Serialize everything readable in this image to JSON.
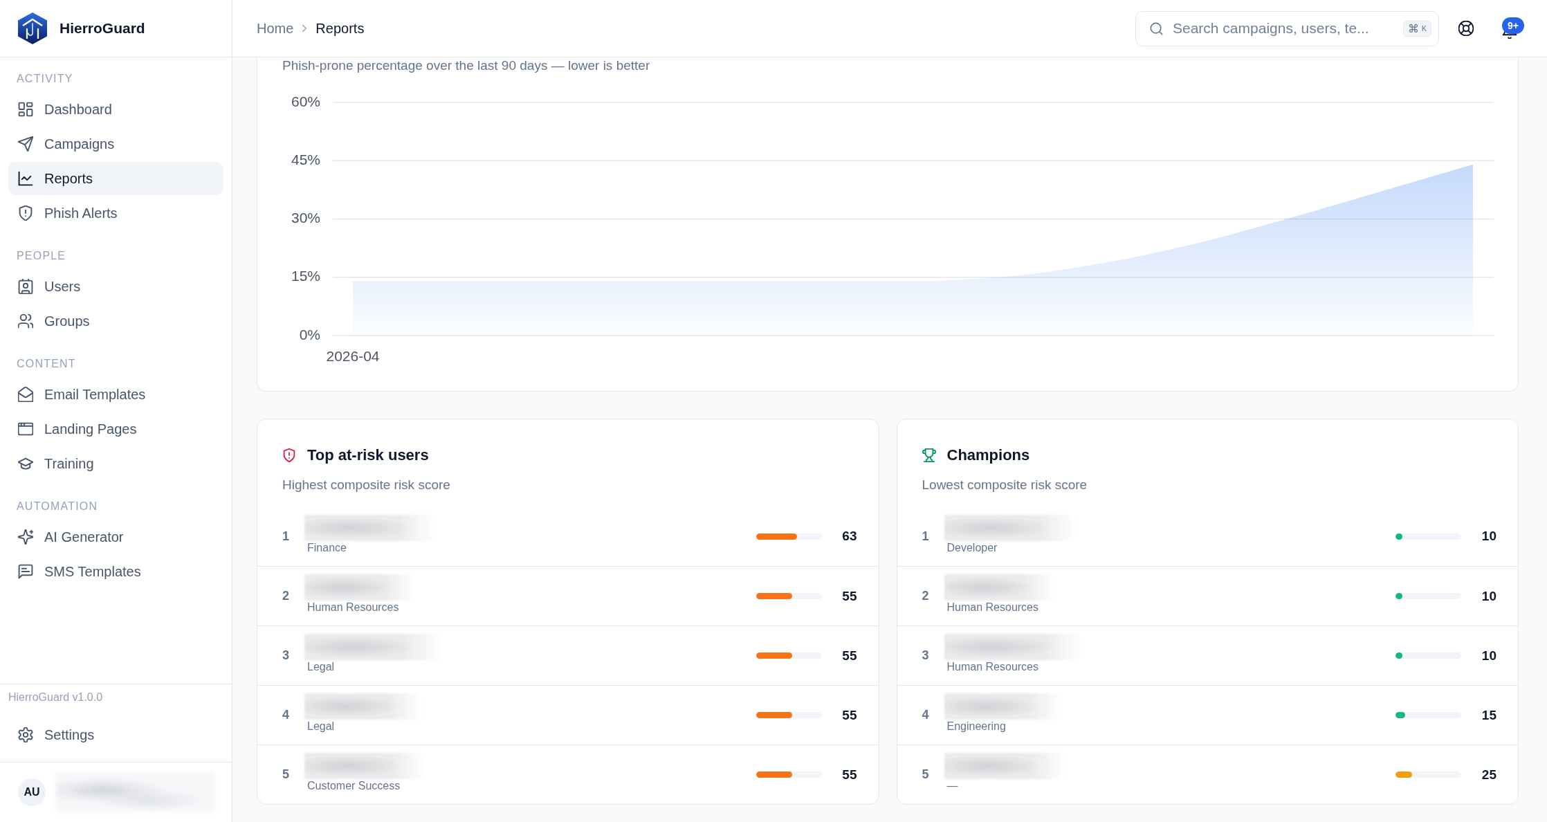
{
  "sidebar": {
    "brand": "HierroGuard",
    "sections": [
      {
        "label": "ACTIVITY",
        "items": [
          {
            "label": "Dashboard",
            "selected": false
          },
          {
            "label": "Campaigns",
            "selected": false
          },
          {
            "label": "Reports",
            "selected": true
          },
          {
            "label": "Phish Alerts",
            "selected": false
          }
        ]
      },
      {
        "label": "PEOPLE",
        "items": [
          {
            "label": "Users",
            "selected": false
          },
          {
            "label": "Groups",
            "selected": false
          }
        ]
      },
      {
        "label": "CONTENT",
        "items": [
          {
            "label": "Email Templates",
            "selected": false
          },
          {
            "label": "Landing Pages",
            "selected": false
          },
          {
            "label": "Training",
            "selected": false
          }
        ]
      },
      {
        "label": "AUTOMATION",
        "items": [
          {
            "label": "AI Generator",
            "selected": false
          },
          {
            "label": "SMS Templates",
            "selected": false
          }
        ]
      }
    ],
    "version": "HierroGuard v1.0.0",
    "settings": "Settings",
    "user": {
      "initials": "AU"
    }
  },
  "header": {
    "breadcrumb": [
      "Home",
      "Reports"
    ],
    "search": {
      "placeholder": "Search campaigns, users, te...",
      "shortcut": [
        "⌘",
        "K"
      ]
    },
    "notifications": {
      "badge": "9+"
    }
  },
  "trend_card": {
    "subtitle": "Phish-prone percentage over the last 90 days — lower is better",
    "x_axis_start": "2026-04",
    "chart_data": {
      "type": "area",
      "grid": true,
      "ylim": [
        0,
        60
      ],
      "yticks": [
        {
          "value": 0,
          "label": "0%"
        },
        {
          "value": 15,
          "label": "15%"
        },
        {
          "value": 30,
          "label": "30%"
        },
        {
          "value": 45,
          "label": "45%"
        },
        {
          "value": 60,
          "label": "60%"
        }
      ],
      "series": [
        {
          "values": [
            14,
            14,
            14,
            14,
            14,
            14,
            14,
            15.2,
            18.5,
            23.5,
            30,
            37,
            44
          ]
        }
      ]
    }
  },
  "at_risk": {
    "title": "Top at-risk users",
    "subtitle": "Highest composite risk score",
    "rows": [
      {
        "rank": "1",
        "department": "Finance",
        "level": 0.63,
        "score": "63",
        "color": "#f97316"
      },
      {
        "rank": "2",
        "department": "Human Resources",
        "level": 0.55,
        "score": "55",
        "color": "#f97316"
      },
      {
        "rank": "3",
        "department": "Legal",
        "level": 0.55,
        "score": "55",
        "color": "#f97316"
      },
      {
        "rank": "4",
        "department": "Legal",
        "level": 0.55,
        "score": "55",
        "color": "#f97316"
      },
      {
        "rank": "5",
        "department": "Customer Success",
        "level": 0.55,
        "score": "55",
        "color": "#f97316"
      }
    ]
  },
  "champions": {
    "title": "Champions",
    "subtitle": "Lowest composite risk score",
    "rows": [
      {
        "rank": "1",
        "department": "Developer",
        "level": 0.1,
        "score": "10",
        "color": "#10b981"
      },
      {
        "rank": "2",
        "department": "Human Resources",
        "level": 0.1,
        "score": "10",
        "color": "#10b981"
      },
      {
        "rank": "3",
        "department": "Human Resources",
        "level": 0.1,
        "score": "10",
        "color": "#10b981"
      },
      {
        "rank": "4",
        "department": "Engineering",
        "level": 0.15,
        "score": "15",
        "color": "#10b981"
      },
      {
        "rank": "5",
        "department": "—",
        "level": 0.25,
        "score": "25",
        "color": "#f59e0b"
      }
    ]
  }
}
